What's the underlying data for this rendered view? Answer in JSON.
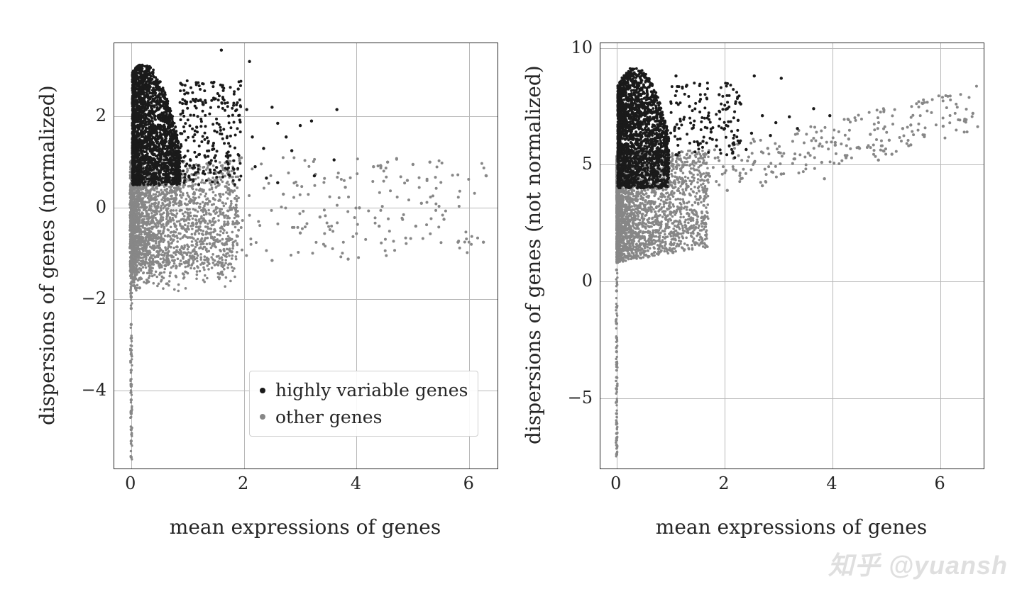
{
  "watermark": "知乎 @yuansh",
  "chart_data": [
    {
      "type": "scatter",
      "xlabel": "mean expressions of genes",
      "ylabel": "dispersions of genes (normalized)",
      "xlim": [
        -0.3,
        6.5
      ],
      "ylim": [
        -5.7,
        3.6
      ],
      "xticks": [
        0,
        2,
        4,
        6
      ],
      "yticks": [
        -4,
        -2,
        0,
        2
      ],
      "legend": {
        "entries": [
          {
            "label": "highly variable genes",
            "color": "#1a1a1a"
          },
          {
            "label": "other genes",
            "color": "#878787"
          }
        ],
        "position": "lower right"
      },
      "series": [
        {
          "name": "other genes",
          "color": "#878787",
          "description": "dense cloud of gray points concentrated near x≈0, y between roughly -1.8 and 0.5, with a thin vertical tail at x≈0 extending down to y≈-5.5, and scattered points out to x≈6.3 with y roughly -1.2 to 1.0",
          "points_sample": [
            [
              0.0,
              -5.45
            ],
            [
              0.0,
              -5.1
            ],
            [
              0.0,
              -4.85
            ],
            [
              0.0,
              -4.5
            ],
            [
              0.0,
              -4.2
            ],
            [
              0.0,
              -3.9
            ],
            [
              0.0,
              -3.55
            ],
            [
              0.0,
              -3.2
            ],
            [
              0.0,
              -2.85
            ],
            [
              0.0,
              -2.55
            ],
            [
              0.0,
              -2.2
            ],
            [
              0.0,
              -1.95
            ],
            [
              0.05,
              -1.7
            ],
            [
              0.08,
              -1.55
            ],
            [
              0.05,
              -1.35
            ],
            [
              0.1,
              -1.15
            ],
            [
              0.1,
              -0.9
            ],
            [
              0.12,
              -0.65
            ],
            [
              0.15,
              -1.75
            ],
            [
              0.02,
              -0.3
            ],
            [
              0.05,
              0.2
            ],
            [
              2.5,
              -1.15
            ],
            [
              2.7,
              0.3
            ],
            [
              3.0,
              -0.55
            ],
            [
              3.35,
              -0.2
            ],
            [
              3.8,
              0.45
            ],
            [
              3.85,
              -1.12
            ],
            [
              4.05,
              0.0
            ],
            [
              4.3,
              0.9
            ],
            [
              4.4,
              -0.4
            ],
            [
              4.55,
              1.0
            ],
            [
              4.9,
              0.6
            ],
            [
              5.05,
              -0.4
            ],
            [
              5.3,
              1.0
            ],
            [
              5.55,
              -0.25
            ],
            [
              5.8,
              -0.75
            ],
            [
              6.3,
              0.7
            ],
            [
              6.25,
              -0.75
            ],
            [
              5.15,
              0.1
            ],
            [
              5.0,
              0.95
            ]
          ]
        },
        {
          "name": "highly variable genes",
          "color": "#1a1a1a",
          "description": "dense black cloud roughly at x 0.0–0.8, y 0.5–3.1, plus scattered black points up to x≈3.5",
          "points_sample": [
            [
              1.9,
              2.6
            ],
            [
              2.05,
              2.15
            ],
            [
              2.15,
              1.55
            ],
            [
              2.2,
              0.9
            ],
            [
              2.35,
              1.3
            ],
            [
              2.4,
              0.65
            ],
            [
              2.5,
              2.2
            ],
            [
              2.6,
              1.85
            ],
            [
              2.6,
              0.55
            ],
            [
              2.75,
              1.55
            ],
            [
              2.85,
              1.25
            ],
            [
              3.0,
              1.8
            ],
            [
              3.2,
              1.9
            ],
            [
              3.25,
              0.7
            ],
            [
              3.6,
              1.05
            ],
            [
              3.65,
              2.15
            ],
            [
              2.1,
              3.2
            ],
            [
              1.6,
              3.45
            ]
          ]
        }
      ]
    },
    {
      "type": "scatter",
      "xlabel": "mean expressions of genes",
      "ylabel": "dispersions of genes (not normalized)",
      "xlim": [
        -0.3,
        6.8
      ],
      "ylim": [
        -8.0,
        10.2
      ],
      "xticks": [
        0,
        2,
        4,
        6
      ],
      "yticks": [
        -5,
        0,
        5,
        10
      ],
      "legend": null,
      "series": [
        {
          "name": "other genes",
          "color": "#878787",
          "description": "dense gray cloud concentrated at x 0–1.5 y 1–5.5, thin vertical tail at x≈0 down to y≈-7.5, scattered gray points forming a slightly rising band out to x≈6.5 around y≈5–7",
          "points_sample": [
            [
              0.0,
              -7.4
            ],
            [
              0.0,
              -7.0
            ],
            [
              0.0,
              -6.5
            ],
            [
              0.0,
              -6.05
            ],
            [
              0.0,
              -5.65
            ],
            [
              0.0,
              -5.15
            ],
            [
              0.0,
              -4.6
            ],
            [
              0.0,
              -4.1
            ],
            [
              0.0,
              -3.55
            ],
            [
              0.0,
              -3.0
            ],
            [
              0.0,
              -2.4
            ],
            [
              0.0,
              -1.8
            ],
            [
              0.0,
              -1.1
            ],
            [
              0.0,
              -0.4
            ],
            [
              0.0,
              0.5
            ],
            [
              2.05,
              3.9
            ],
            [
              2.3,
              4.4
            ],
            [
              2.55,
              5.1
            ],
            [
              2.7,
              4.1
            ],
            [
              2.8,
              5.7
            ],
            [
              3.05,
              4.6
            ],
            [
              3.3,
              5.25
            ],
            [
              3.55,
              5.5
            ],
            [
              3.8,
              5.1
            ],
            [
              3.85,
              4.4
            ],
            [
              4.05,
              5.95
            ],
            [
              4.25,
              5.3
            ],
            [
              4.3,
              6.1
            ],
            [
              4.5,
              5.7
            ],
            [
              4.7,
              6.3
            ],
            [
              4.85,
              5.2
            ],
            [
              5.05,
              6.05
            ],
            [
              5.1,
              5.45
            ],
            [
              5.3,
              6.55
            ],
            [
              5.45,
              5.85
            ],
            [
              5.45,
              6.7
            ],
            [
              5.7,
              6.2
            ],
            [
              6.05,
              6.65
            ],
            [
              6.45,
              6.95
            ],
            [
              6.6,
              7.2
            ]
          ]
        },
        {
          "name": "highly variable genes",
          "color": "#1a1a1a",
          "description": "dense black cloud at x 0–1 y 4–9.2 forming an arched shape; scattered black points to x≈4",
          "points_sample": [
            [
              1.6,
              6.0
            ],
            [
              1.7,
              7.1
            ],
            [
              1.75,
              6.4
            ],
            [
              1.85,
              5.8
            ],
            [
              1.9,
              8.0
            ],
            [
              2.0,
              6.55
            ],
            [
              2.05,
              7.4
            ],
            [
              2.15,
              5.5
            ],
            [
              2.25,
              6.9
            ],
            [
              2.3,
              7.6
            ],
            [
              2.4,
              5.65
            ],
            [
              2.5,
              6.35
            ],
            [
              2.55,
              8.8
            ],
            [
              2.7,
              7.1
            ],
            [
              2.85,
              6.25
            ],
            [
              2.95,
              6.8
            ],
            [
              3.05,
              8.7
            ],
            [
              3.2,
              7.05
            ],
            [
              3.35,
              6.55
            ],
            [
              3.65,
              7.4
            ],
            [
              3.95,
              7.1
            ],
            [
              1.3,
              8.4
            ],
            [
              1.1,
              8.8
            ],
            [
              1.35,
              7.5
            ]
          ]
        }
      ]
    }
  ]
}
